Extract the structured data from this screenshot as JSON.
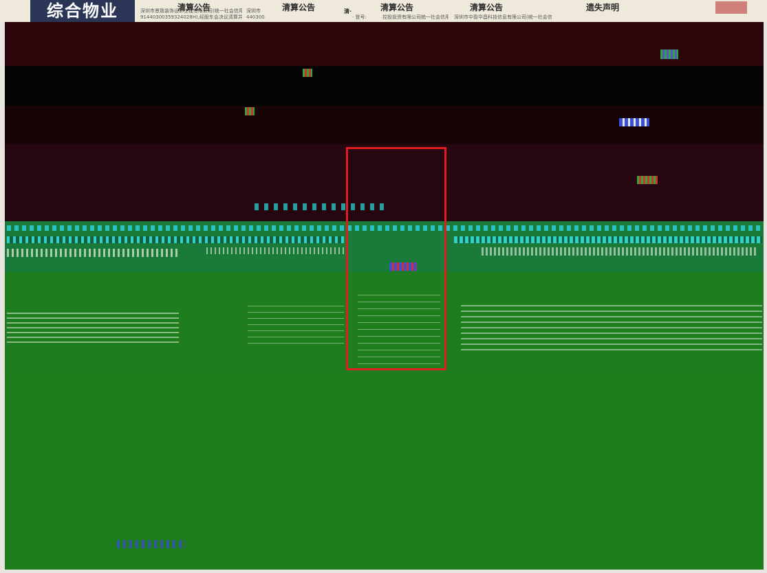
{
  "newspaper": {
    "banner": "综合物业",
    "headings": [
      "清算公告",
      "清算公告",
      "清算公告",
      "清算公告",
      "遗失声明"
    ],
    "fragments": [
      "深圳市景致装饰设计工程有限公司(统一社会信用代码:",
      "91440300359324028H),经股东会决议清算并注销,",
      "深圳市",
      "440300",
      "· 登号:",
      "控投投资有限公司统一社会信用代码",
      "深圳市中盈华昌科技信息有限公司(统一社会信",
      "清·"
    ]
  },
  "colors": {
    "annotation_box": "#e11d1d",
    "noise_green": "#1f8a1f",
    "noise_cyan": "#27c3c3",
    "noise_maroon": "#3a0a12"
  }
}
